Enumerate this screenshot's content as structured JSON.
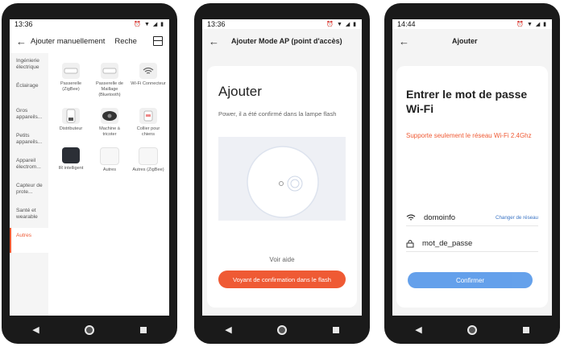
{
  "colors": {
    "accent": "#ef5a34",
    "link": "#3a74c4",
    "primary_button": "#4a90e8"
  },
  "screen1": {
    "status_time": "13:36",
    "title": "Ajouter manuellement",
    "search_label": "Reche",
    "categories": [
      {
        "label": "Ingénierie électrique"
      },
      {
        "label": "Éclairage"
      },
      {
        "label": "Gros appareils..."
      },
      {
        "label": "Petits appareils..."
      },
      {
        "label": "Appareil électrom..."
      },
      {
        "label": "Capteur de prote..."
      },
      {
        "label": "Santé et wearable"
      },
      {
        "label": "Autres"
      }
    ],
    "devices": [
      {
        "label": "Passerelle (ZigBee)",
        "icon": "gateway-icon"
      },
      {
        "label": "Passerelle de Maillage (Bluetooth)",
        "icon": "gateway-icon"
      },
      {
        "label": "Wi-Fi Connecteur",
        "icon": "wifi-icon"
      },
      {
        "label": "Distributeur",
        "icon": "dispenser-icon"
      },
      {
        "label": "Machine à tricoter",
        "icon": "machine-icon"
      },
      {
        "label": "Collier pour chiens",
        "icon": "collar-icon"
      },
      {
        "label": "IR intelligent",
        "icon": "ir-remote-icon"
      },
      {
        "label": "Autres",
        "icon": "other-device-icon"
      },
      {
        "label": "Autres (ZigBee)",
        "icon": "other-device-icon"
      }
    ]
  },
  "screen2": {
    "status_time": "13:36",
    "title": "Ajouter  Mode AP (point d'accès)",
    "heading": "Ajouter",
    "subtitle": "Power, il a été confirmé dans la lampe flash",
    "help_link": "Voir aide",
    "confirm_button": "Voyant de confirmation dans le flash"
  },
  "screen3": {
    "status_time": "14:44",
    "title": "Ajouter",
    "heading": "Entrer le mot de passe Wi-Fi",
    "warning": "Supporte seulement le réseau Wi-Fi 2.4Ghz",
    "network_name": "domoinfo",
    "change_network": "Changer de réseau",
    "password_value": "mot_de_passe",
    "confirm_button": "Confirmer"
  }
}
